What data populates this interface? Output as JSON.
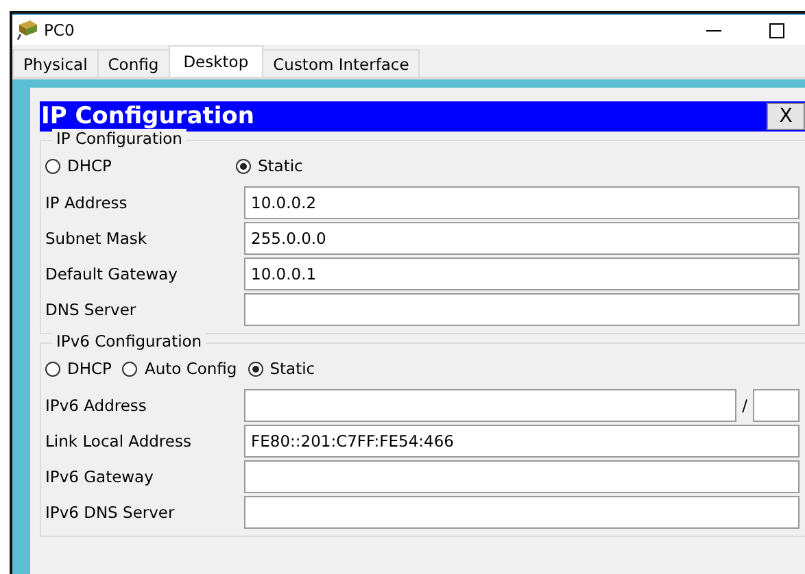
{
  "window": {
    "title": "PC0"
  },
  "tabs": [
    {
      "label": "Physical",
      "selected": false
    },
    {
      "label": "Config",
      "selected": false
    },
    {
      "label": "Desktop",
      "selected": true
    },
    {
      "label": "Custom Interface",
      "selected": false
    }
  ],
  "dialog": {
    "title": "IP Configuration",
    "close": "X",
    "groups": [
      {
        "legend": "IP Configuration",
        "modes": [
          {
            "label": "DHCP",
            "selected": false
          },
          {
            "label": "Static",
            "selected": true
          }
        ],
        "fields": [
          {
            "kind": "plain",
            "label": "IP Address",
            "value": "10.0.0.2"
          },
          {
            "kind": "plain",
            "label": "Subnet Mask",
            "value": "255.0.0.0"
          },
          {
            "kind": "plain",
            "label": "Default Gateway",
            "value": "10.0.0.1"
          },
          {
            "kind": "plain",
            "label": "DNS Server"
          }
        ]
      },
      {
        "legend": "IPv6 Configuration",
        "modes": [
          {
            "label": "DHCP",
            "selected": false
          },
          {
            "label": "Auto Config",
            "selected": false
          },
          {
            "label": "Static",
            "selected": true
          }
        ],
        "fields": [
          {
            "kind": "prefixed",
            "label": "IPv6 Address",
            "separator": "/"
          },
          {
            "kind": "plain",
            "label": "Link Local Address",
            "value": "FE80::201:C7FF:FE54:466"
          },
          {
            "kind": "plain",
            "label": "IPv6 Gateway"
          },
          {
            "kind": "plain",
            "label": "IPv6 DNS Server"
          }
        ]
      }
    ]
  }
}
